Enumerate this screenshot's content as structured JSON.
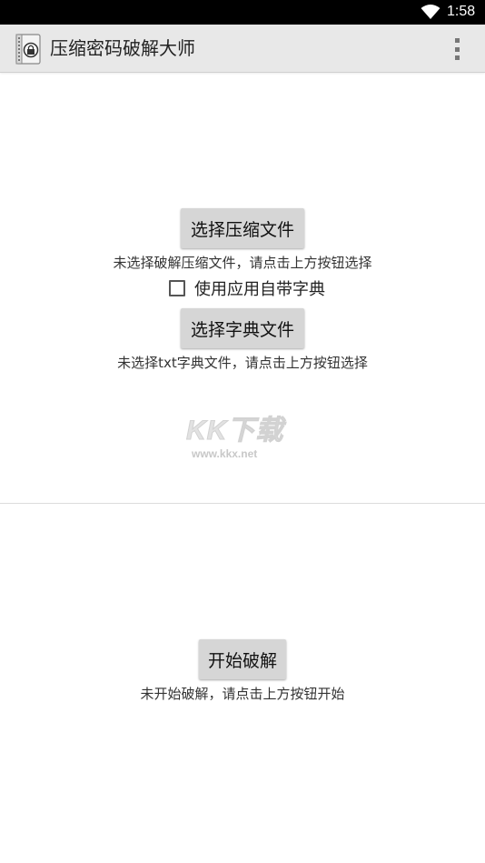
{
  "status_bar": {
    "time": "1:58",
    "wifi_icon": "wifi-icon"
  },
  "action_bar": {
    "title": "压缩密码破解大师",
    "app_icon": "zip-lock-icon",
    "menu_icon": "overflow-menu-icon"
  },
  "archive_section": {
    "button_label": "选择压缩文件",
    "hint": "未选择破解压缩文件，请点击上方按钮选择"
  },
  "builtin_dict": {
    "label": "使用应用自带字典",
    "checked": false
  },
  "dict_section": {
    "button_label": "选择字典文件",
    "hint": "未选择txt字典文件，请点击上方按钮选择"
  },
  "watermark": {
    "logo": "KK下载",
    "url": "www.kkx.net"
  },
  "start_section": {
    "button_label": "开始破解",
    "hint": "未开始破解，请点击上方按钮开始"
  }
}
